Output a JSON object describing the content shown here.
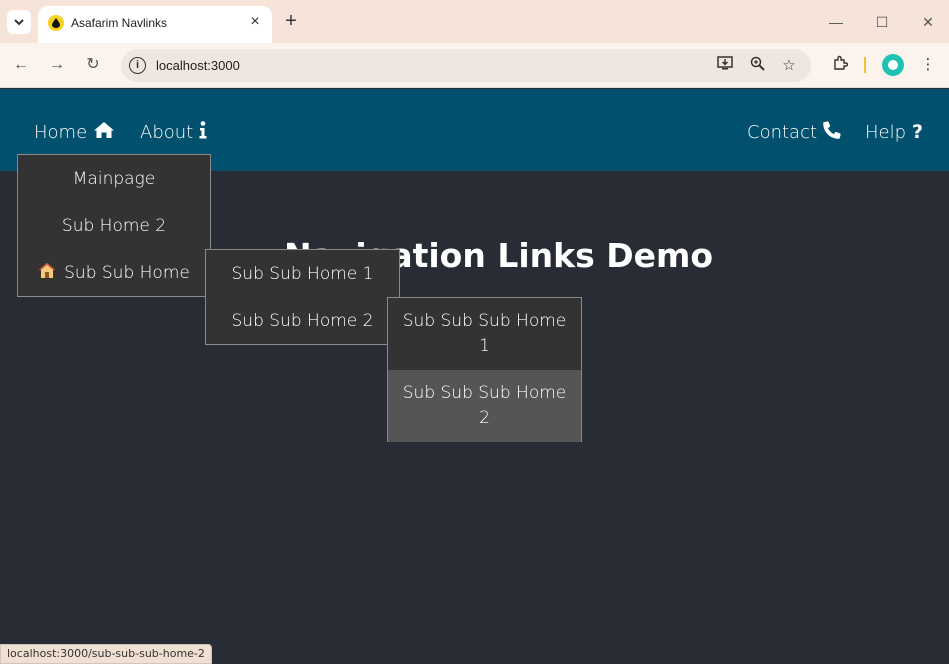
{
  "browser": {
    "tab_title": "Asafarim Navlinks",
    "url": "localhost:3000",
    "status_url": "localhost:3000/sub-sub-sub-home-2",
    "icons": [
      "tab-search-icon",
      "favicon-icon",
      "close-icon",
      "new-tab-icon",
      "minimize-icon",
      "maximize-icon",
      "window-close-icon",
      "back-icon",
      "forward-icon",
      "reload-icon",
      "site-info-icon",
      "install-app-icon",
      "zoom-icon",
      "bookmark-star-icon",
      "extensions-icon",
      "profile-icon",
      "menu-icon"
    ]
  },
  "nav": {
    "left": [
      {
        "label": "Home",
        "icon": "house-icon"
      },
      {
        "label": "About",
        "icon": "info-icon"
      }
    ],
    "right": [
      {
        "label": "Contact",
        "icon": "phone-icon"
      },
      {
        "label": "Help",
        "icon": "question-icon"
      }
    ]
  },
  "heading": "Navigation Links Demo",
  "menus": {
    "home": [
      "Mainpage",
      "Sub Home 2",
      "Sub Sub Home"
    ],
    "sub_sub_home": [
      "Sub Sub Home 1",
      "Sub Sub Home 2"
    ],
    "sub_sub_sub": [
      "Sub Sub Sub Home 1",
      "Sub Sub Sub Home 2"
    ]
  },
  "colors": {
    "nav_bg": "#01506e",
    "page_bg": "#282c34",
    "menu_bg": "#333333",
    "menu_hover": "#555555"
  }
}
